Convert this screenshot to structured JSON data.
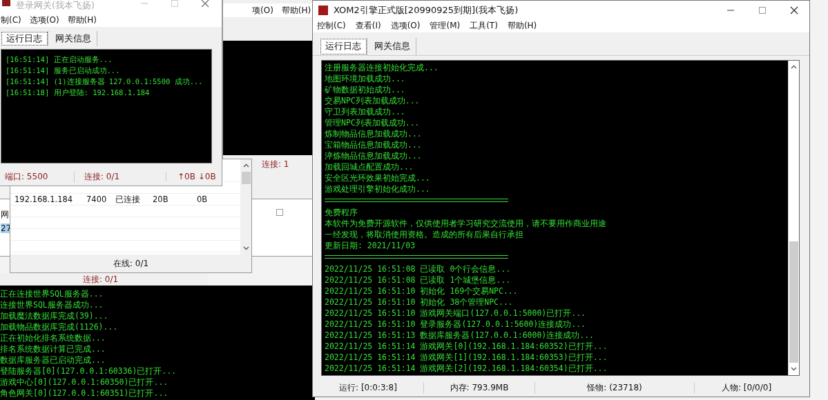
{
  "back_window": {
    "menu": [
      "项(O)",
      "帮助(H)"
    ],
    "status": "连接: 1"
  },
  "side_window": {
    "cells": [
      "网",
      "27"
    ]
  },
  "database_window": {
    "status": "连接: 0/1",
    "log": [
      "正在连接世界SQL服务器...",
      "连接世界SQL服务器成功...",
      "加载魔法数据库完成(39)...",
      "加载物品数据库完成(1126)...",
      "正在初始化排名系统数据...",
      "排名系统数据计算已完成...",
      "数据库服务器已启动完成...",
      "登陆服务器[0](127.0.0.1:60336)已打开...",
      "游戏中心[0](127.0.0.1:60350)已打开...",
      "角色网关[0](127.0.0.1:60351)已打开..."
    ]
  },
  "gateway_list": {
    "rows": [
      [
        "192.168.1.184",
        "7400",
        "已连接",
        "20B",
        "0B"
      ]
    ],
    "status": "在线: 0/1"
  },
  "login_gateway": {
    "title": "登录网关(我本飞扬)",
    "menu": [
      "制(C)",
      "选项(O)",
      "帮助(H)"
    ],
    "tabs": [
      {
        "label": "运行日志",
        "selected": true
      },
      {
        "label": "网关信息",
        "selected": false
      }
    ],
    "log": [
      "[16:51:14] 正在启动服务...",
      "[16:51:14] 服务已启动成功...",
      "[16:51:14] (1)连接服务器 127.0.0.1:5500 成功...",
      "[16:51:18] 用户登陆: 192.168.1.184"
    ],
    "status": [
      {
        "kind": "text",
        "text": "端口: 5500"
      },
      {
        "kind": "text",
        "text": "连接: 0/1"
      },
      {
        "kind": "traffic",
        "text": "↑0B ↓0B"
      }
    ]
  },
  "main_window": {
    "title": "XOM2引擎正式版[20990925到期](我本飞扬)",
    "menu": [
      "控制(C)",
      "查看(I)",
      "选项(O)",
      "管理(M)",
      "工具(T)",
      "帮助(H)"
    ],
    "tabs": [
      {
        "label": "运行日志",
        "selected": true
      },
      {
        "label": "网关信息",
        "selected": false
      }
    ],
    "log": [
      {
        "kind": "text",
        "text": "注册服务器连接初始化完成..."
      },
      {
        "kind": "text",
        "text": "地图环境加载成功..."
      },
      {
        "kind": "text",
        "text": "矿物数据初始成功..."
      },
      {
        "kind": "text",
        "text": "交易NPC列表加载成功..."
      },
      {
        "kind": "text",
        "text": "守卫列表加载成功..."
      },
      {
        "kind": "text",
        "text": "管理NPC列表加载成功..."
      },
      {
        "kind": "text",
        "text": "炼制物品信息加载成功..."
      },
      {
        "kind": "text",
        "text": "宝箱物品信息加载成功..."
      },
      {
        "kind": "text",
        "text": "淬炼物品信息加载成功..."
      },
      {
        "kind": "text",
        "text": "加载回城点配置成功..."
      },
      {
        "kind": "text",
        "text": "安全区光环效果初始完成..."
      },
      {
        "kind": "text",
        "text": "游戏处理引擎初始化成功..."
      },
      {
        "kind": "rule"
      },
      {
        "kind": "text",
        "text": "免费程序"
      },
      {
        "kind": "text",
        "text": "本软件为免费开源软件，仅供使用者学习研究交流使用，请不要用作商业用途"
      },
      {
        "kind": "text",
        "text": "一经发现，将取消使用资格。造成的所有后果自行承担"
      },
      {
        "kind": "text",
        "text": "更新日期: 2021/11/03"
      },
      {
        "kind": "rule"
      },
      {
        "kind": "text",
        "text": "2022/11/25 16:51:08 已读取 0个行会信息..."
      },
      {
        "kind": "text",
        "text": "2022/11/25 16:51:08 已读取 1个城堡信息..."
      },
      {
        "kind": "text",
        "text": "2022/11/25 16:51:10 初始化 169个交易NPC..."
      },
      {
        "kind": "text",
        "text": "2022/11/25 16:51:10 初始化 38个管理NPC..."
      },
      {
        "kind": "text",
        "text": "2022/11/25 16:51:10 游戏网关端口(127.0.0.1:5000)已打开..."
      },
      {
        "kind": "text",
        "text": "2022/11/25 16:51:10 登录服务器(127.0.0.1:5600)连接成功..."
      },
      {
        "kind": "text",
        "text": "2022/11/25 16:51:13 数据库服务器(127.0.0.1:6000)连接成功..."
      },
      {
        "kind": "text",
        "text": "2022/11/25 16:51:14 游戏网关[0](192.168.1.184:60352)已打开..."
      },
      {
        "kind": "text",
        "text": "2022/11/25 16:51:14 游戏网关[1](192.168.1.184:60353)已打开..."
      },
      {
        "kind": "text",
        "text": "2022/11/25 16:51:14 游戏网关[2](192.168.1.184:60354)已打开..."
      }
    ],
    "status": [
      "运行: [0:0:3:8]",
      "内存: 793.9MB",
      "怪物: (23718)",
      "人物: [0/0/0]"
    ]
  }
}
